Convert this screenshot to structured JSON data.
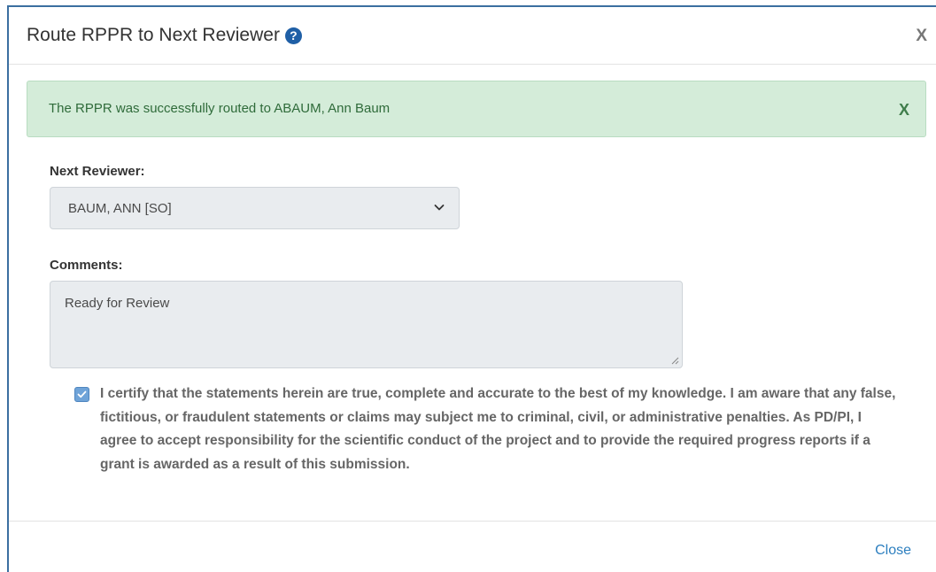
{
  "modal": {
    "title": "Route RPPR to Next Reviewer",
    "help_icon_glyph": "?",
    "close_glyph": "X"
  },
  "alert": {
    "message": "The RPPR was successfully routed to ABAUM, Ann Baum",
    "close_glyph": "X",
    "bg_color": "#d4ecd9"
  },
  "form": {
    "next_reviewer_label": "Next Reviewer:",
    "next_reviewer_value": "BAUM, ANN [SO]",
    "comments_label": "Comments:",
    "comments_value": "Ready for Review",
    "certify_checked": true,
    "certify_text": "I certify that the statements herein are true, complete and accurate to the best of my knowledge. I am aware that any false, fictitious, or fraudulent statements or claims may subject me to criminal, civil, or administrative penalties. As PD/PI, I agree to accept responsibility for the scientific conduct of the project and to provide the required progress reports if a grant is awarded as a result of this submission."
  },
  "footer": {
    "close_label": "Close"
  },
  "colors": {
    "accent": "#1f5fa6",
    "link": "#2d7fbf",
    "success_text": "#2f6b3a"
  }
}
